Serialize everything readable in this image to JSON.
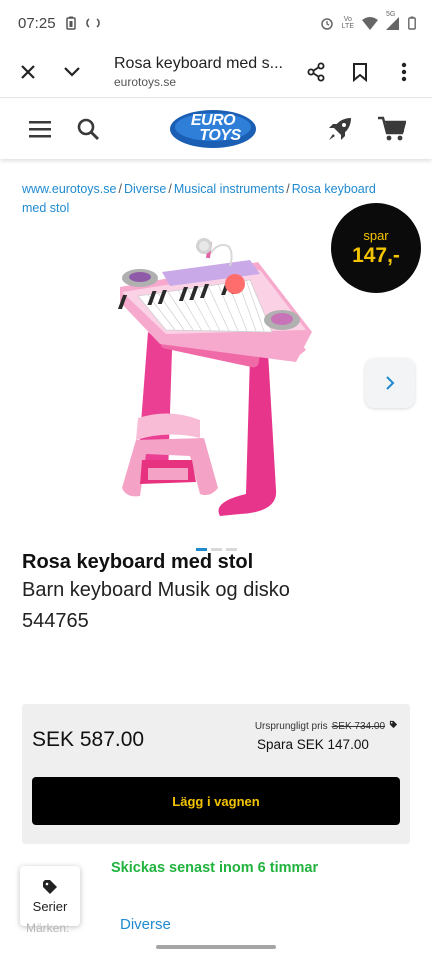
{
  "status_bar": {
    "time": "07:25",
    "network_label": "LTE",
    "signal_label": "5G"
  },
  "browser": {
    "page_title": "Rosa keyboard med s...",
    "url": "eurotoys.se",
    "icons": [
      "close-icon",
      "chevron-down-icon",
      "share-icon",
      "bookmark-icon",
      "more-vert-icon"
    ]
  },
  "site_header": {
    "logo_line1": "EURO",
    "logo_line2": "TOYS",
    "icons": [
      "menu-icon",
      "search-icon",
      "rocket-icon",
      "cart-icon"
    ]
  },
  "breadcrumb": {
    "items": [
      "www.eurotoys.se",
      "Diverse",
      "Musical instruments",
      "Rosa keyboard med stol"
    ]
  },
  "badge": {
    "label": "spar",
    "amount": "147,-"
  },
  "gallery": {
    "current_image": 1,
    "image_count": 3
  },
  "product": {
    "title": "Rosa keyboard med stol",
    "subtitle": "Barn keyboard Musik og disko",
    "sku": "544765"
  },
  "pricing": {
    "price": "SEK 587.00",
    "original_label": "Ursprungligt pris",
    "original_price": "SEK 734.00",
    "save_text": "Spara SEK 147.00",
    "cart_button": "Lägg i vagnen"
  },
  "shipping": {
    "text": "Skickas senast inom 6 timmar"
  },
  "serier": {
    "label": "Serier"
  },
  "brand": {
    "label": "Märken:",
    "value": "Diverse"
  },
  "colors": {
    "link": "#1f8ad0",
    "accent_yellow": "#f5c400",
    "ship_green": "#22b33f",
    "logo_blue": "#1a5fb4"
  }
}
